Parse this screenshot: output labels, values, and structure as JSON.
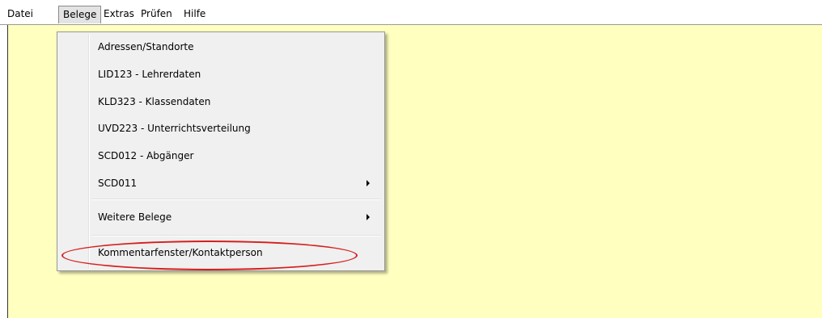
{
  "menubar": {
    "items": [
      "Datei",
      "Belege",
      "Extras",
      "Prüfen",
      "Hilfe"
    ]
  },
  "dropdown": {
    "items": [
      {
        "label": "Adressen/Standorte"
      },
      {
        "label": "LID123 - Lehrerdaten"
      },
      {
        "label": "KLD323 - Klassendaten"
      },
      {
        "label": "UVD223 - Unterrichtsverteilung"
      },
      {
        "label": "SCD012 - Abgänger"
      },
      {
        "label": "SCD011",
        "submenu_icon": "submenu-arrow-icon"
      },
      {
        "label": "Weitere Belege",
        "submenu_icon": "submenu-arrow-icon"
      },
      {
        "label": "Kommentarfenster/Kontaktperson",
        "annotation": "red-ellipse-highlight"
      }
    ]
  },
  "colors": {
    "workspace_background": "#ffffc0",
    "menu_background": "#f0f0f0",
    "annotation_color": "#d61f1f"
  }
}
